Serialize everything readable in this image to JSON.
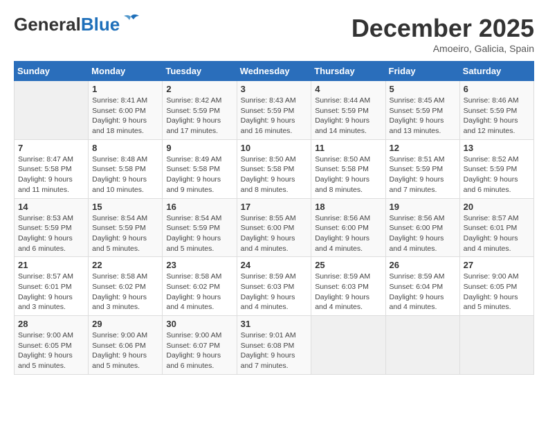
{
  "header": {
    "logo_general": "General",
    "logo_blue": "Blue",
    "title": "December 2025",
    "subtitle": "Amoeiro, Galicia, Spain"
  },
  "calendar": {
    "weekdays": [
      "Sunday",
      "Monday",
      "Tuesday",
      "Wednesday",
      "Thursday",
      "Friday",
      "Saturday"
    ],
    "weeks": [
      [
        {
          "day": "",
          "info": ""
        },
        {
          "day": "1",
          "info": "Sunrise: 8:41 AM\nSunset: 6:00 PM\nDaylight: 9 hours\nand 18 minutes."
        },
        {
          "day": "2",
          "info": "Sunrise: 8:42 AM\nSunset: 5:59 PM\nDaylight: 9 hours\nand 17 minutes."
        },
        {
          "day": "3",
          "info": "Sunrise: 8:43 AM\nSunset: 5:59 PM\nDaylight: 9 hours\nand 16 minutes."
        },
        {
          "day": "4",
          "info": "Sunrise: 8:44 AM\nSunset: 5:59 PM\nDaylight: 9 hours\nand 14 minutes."
        },
        {
          "day": "5",
          "info": "Sunrise: 8:45 AM\nSunset: 5:59 PM\nDaylight: 9 hours\nand 13 minutes."
        },
        {
          "day": "6",
          "info": "Sunrise: 8:46 AM\nSunset: 5:59 PM\nDaylight: 9 hours\nand 12 minutes."
        }
      ],
      [
        {
          "day": "7",
          "info": "Sunrise: 8:47 AM\nSunset: 5:58 PM\nDaylight: 9 hours\nand 11 minutes."
        },
        {
          "day": "8",
          "info": "Sunrise: 8:48 AM\nSunset: 5:58 PM\nDaylight: 9 hours\nand 10 minutes."
        },
        {
          "day": "9",
          "info": "Sunrise: 8:49 AM\nSunset: 5:58 PM\nDaylight: 9 hours\nand 9 minutes."
        },
        {
          "day": "10",
          "info": "Sunrise: 8:50 AM\nSunset: 5:58 PM\nDaylight: 9 hours\nand 8 minutes."
        },
        {
          "day": "11",
          "info": "Sunrise: 8:50 AM\nSunset: 5:58 PM\nDaylight: 9 hours\nand 8 minutes."
        },
        {
          "day": "12",
          "info": "Sunrise: 8:51 AM\nSunset: 5:59 PM\nDaylight: 9 hours\nand 7 minutes."
        },
        {
          "day": "13",
          "info": "Sunrise: 8:52 AM\nSunset: 5:59 PM\nDaylight: 9 hours\nand 6 minutes."
        }
      ],
      [
        {
          "day": "14",
          "info": "Sunrise: 8:53 AM\nSunset: 5:59 PM\nDaylight: 9 hours\nand 6 minutes."
        },
        {
          "day": "15",
          "info": "Sunrise: 8:54 AM\nSunset: 5:59 PM\nDaylight: 9 hours\nand 5 minutes."
        },
        {
          "day": "16",
          "info": "Sunrise: 8:54 AM\nSunset: 5:59 PM\nDaylight: 9 hours\nand 5 minutes."
        },
        {
          "day": "17",
          "info": "Sunrise: 8:55 AM\nSunset: 6:00 PM\nDaylight: 9 hours\nand 4 minutes."
        },
        {
          "day": "18",
          "info": "Sunrise: 8:56 AM\nSunset: 6:00 PM\nDaylight: 9 hours\nand 4 minutes."
        },
        {
          "day": "19",
          "info": "Sunrise: 8:56 AM\nSunset: 6:00 PM\nDaylight: 9 hours\nand 4 minutes."
        },
        {
          "day": "20",
          "info": "Sunrise: 8:57 AM\nSunset: 6:01 PM\nDaylight: 9 hours\nand 4 minutes."
        }
      ],
      [
        {
          "day": "21",
          "info": "Sunrise: 8:57 AM\nSunset: 6:01 PM\nDaylight: 9 hours\nand 3 minutes."
        },
        {
          "day": "22",
          "info": "Sunrise: 8:58 AM\nSunset: 6:02 PM\nDaylight: 9 hours\nand 3 minutes."
        },
        {
          "day": "23",
          "info": "Sunrise: 8:58 AM\nSunset: 6:02 PM\nDaylight: 9 hours\nand 4 minutes."
        },
        {
          "day": "24",
          "info": "Sunrise: 8:59 AM\nSunset: 6:03 PM\nDaylight: 9 hours\nand 4 minutes."
        },
        {
          "day": "25",
          "info": "Sunrise: 8:59 AM\nSunset: 6:03 PM\nDaylight: 9 hours\nand 4 minutes."
        },
        {
          "day": "26",
          "info": "Sunrise: 8:59 AM\nSunset: 6:04 PM\nDaylight: 9 hours\nand 4 minutes."
        },
        {
          "day": "27",
          "info": "Sunrise: 9:00 AM\nSunset: 6:05 PM\nDaylight: 9 hours\nand 5 minutes."
        }
      ],
      [
        {
          "day": "28",
          "info": "Sunrise: 9:00 AM\nSunset: 6:05 PM\nDaylight: 9 hours\nand 5 minutes."
        },
        {
          "day": "29",
          "info": "Sunrise: 9:00 AM\nSunset: 6:06 PM\nDaylight: 9 hours\nand 5 minutes."
        },
        {
          "day": "30",
          "info": "Sunrise: 9:00 AM\nSunset: 6:07 PM\nDaylight: 9 hours\nand 6 minutes."
        },
        {
          "day": "31",
          "info": "Sunrise: 9:01 AM\nSunset: 6:08 PM\nDaylight: 9 hours\nand 7 minutes."
        },
        {
          "day": "",
          "info": ""
        },
        {
          "day": "",
          "info": ""
        },
        {
          "day": "",
          "info": ""
        }
      ]
    ]
  }
}
